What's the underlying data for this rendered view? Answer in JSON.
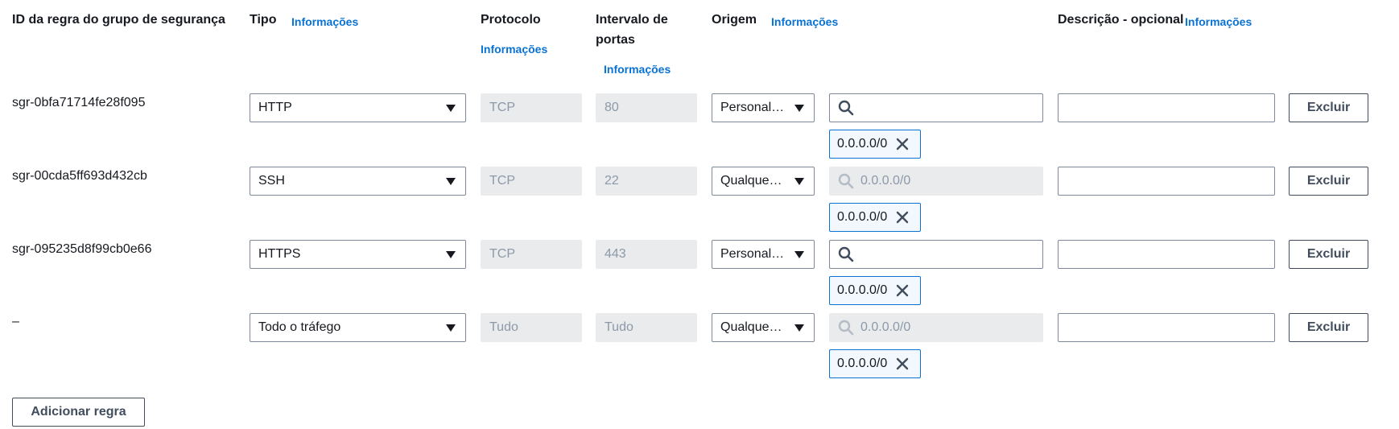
{
  "headers": {
    "rule_id": "ID da regra do grupo de segurança",
    "type": "Tipo",
    "type_info": "Informações",
    "protocol": "Protocolo",
    "protocol_info": "Informações",
    "port_range_line1": "Intervalo de",
    "port_range_line2": "portas",
    "port_range_info": "Informações",
    "source": "Origem",
    "source_info": "Informações",
    "description": "Descrição - opcional",
    "description_info": "Informações"
  },
  "rules": [
    {
      "id": "sgr-0bfa71714fe28f095",
      "type": "HTTP",
      "protocol": "TCP",
      "port_range": "80",
      "source_type": "Personal…",
      "search_placeholder": "",
      "source_token": "0.0.0.0/0",
      "delete_label": "Excluir"
    },
    {
      "id": "sgr-00cda5ff693d432cb",
      "type": "SSH",
      "protocol": "TCP",
      "port_range": "22",
      "source_type": "Qualque…",
      "search_placeholder": "0.0.0.0/0",
      "source_token": "0.0.0.0/0",
      "delete_label": "Excluir"
    },
    {
      "id": "sgr-095235d8f99cb0e66",
      "type": "HTTPS",
      "protocol": "TCP",
      "port_range": "443",
      "source_type": "Personal…",
      "search_placeholder": "",
      "source_token": "0.0.0.0/0",
      "delete_label": "Excluir"
    },
    {
      "id": "–",
      "type": "Todo o tráfego",
      "protocol": "Tudo",
      "port_range": "Tudo",
      "source_type": "Qualque…",
      "search_placeholder": "0.0.0.0/0",
      "source_token": "0.0.0.0/0",
      "delete_label": "Excluir"
    }
  ],
  "add_rule_label": "Adicionar regra",
  "icons": {
    "search": "search-icon",
    "caret": "caret-down-icon",
    "remove": "close-icon"
  },
  "colors": {
    "link": "#0972d3",
    "border": "#7d8998",
    "disabled_bg": "#e9ebed",
    "token_border": "#0972d3"
  }
}
